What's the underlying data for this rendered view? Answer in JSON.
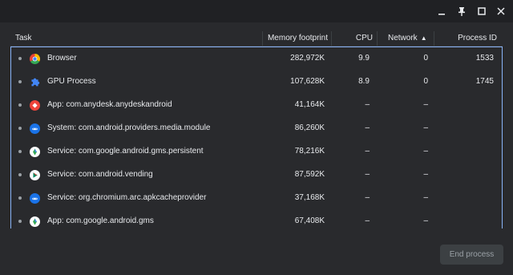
{
  "titlebar": {
    "icons": [
      "minimize-icon",
      "pin-icon",
      "maximize-icon",
      "close-icon"
    ]
  },
  "table": {
    "headers": {
      "task": "Task",
      "memory": "Memory footprint",
      "cpu": "CPU",
      "network": "Network",
      "network_sort": "▲",
      "pid": "Process ID"
    },
    "rows": [
      {
        "icon": "chrome-icon",
        "task": "Browser",
        "memory": "282,972K",
        "cpu": "9.9",
        "network": "0",
        "pid": "1533"
      },
      {
        "icon": "puzzle-icon",
        "task": "GPU Process",
        "memory": "107,628K",
        "cpu": "8.9",
        "network": "0",
        "pid": "1745"
      },
      {
        "icon": "anydesk-icon",
        "task": "App: com.anydesk.anydeskandroid",
        "memory": "41,164K",
        "cpu": "–",
        "network": "–",
        "pid": ""
      },
      {
        "icon": "android-system-icon",
        "task": "System: com.android.providers.media.module",
        "memory": "86,260K",
        "cpu": "–",
        "network": "–",
        "pid": ""
      },
      {
        "icon": "play-services-icon",
        "task": "Service: com.google.android.gms.persistent",
        "memory": "78,216K",
        "cpu": "–",
        "network": "–",
        "pid": ""
      },
      {
        "icon": "play-store-icon",
        "task": "Service: com.android.vending",
        "memory": "87,592K",
        "cpu": "–",
        "network": "–",
        "pid": ""
      },
      {
        "icon": "android-system-icon",
        "task": "Service: org.chromium.arc.apkcacheprovider",
        "memory": "37,168K",
        "cpu": "–",
        "network": "–",
        "pid": ""
      },
      {
        "icon": "play-services-icon",
        "task": "App: com.google.android.gms",
        "memory": "67,408K",
        "cpu": "–",
        "network": "–",
        "pid": ""
      }
    ]
  },
  "footer": {
    "end_process_label": "End process"
  },
  "colors": {
    "selection_border": "#8ab4f8",
    "background": "#292a2d",
    "titlebar": "#202124"
  }
}
